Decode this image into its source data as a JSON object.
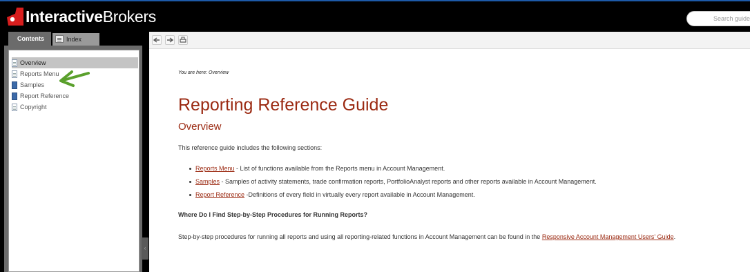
{
  "header": {
    "logo_bold": "Interactive",
    "logo_light": "Brokers",
    "search_placeholder": "Search guide"
  },
  "tabs": {
    "contents": "Contents",
    "index": "Index"
  },
  "toc": [
    {
      "label": "Overview",
      "icon": "page-icon"
    },
    {
      "label": "Reports Menu",
      "icon": "page-icon"
    },
    {
      "label": "Samples",
      "icon": "book-icon"
    },
    {
      "label": "Report Reference",
      "icon": "book-icon"
    },
    {
      "label": "Copyright",
      "icon": "page-icon"
    }
  ],
  "content": {
    "breadcrumb": "You are here: Overview",
    "title": "Reporting Reference Guide",
    "subtitle": "Overview",
    "intro": "This reference guide includes the following sections:",
    "bullets": [
      {
        "link": "Reports Menu",
        "text": " - List of functions available from the Reports menu in Account Management."
      },
      {
        "link": "Samples",
        "text": " - Samples of activity statements, trade confirmation reports, PortfolioAnalyst reports and other reports available in Account Management."
      },
      {
        "link": "Report Reference",
        "text": " -Definitions of every field in virtually every report available in Account Management."
      }
    ],
    "faq_heading": "Where Do I Find Step-by-Step Procedures for Running Reports?",
    "para_text": "Step-by-step procedures for running all reports and using all reporting-related functions in Account Management can be found in the ",
    "para_link": "Responsive Account Management Users' Guide",
    "para_end": "."
  },
  "colors": {
    "accent_red": "#9b2a12",
    "arrow_green": "#5aa02c",
    "book_blue": "#3c6aa8"
  }
}
